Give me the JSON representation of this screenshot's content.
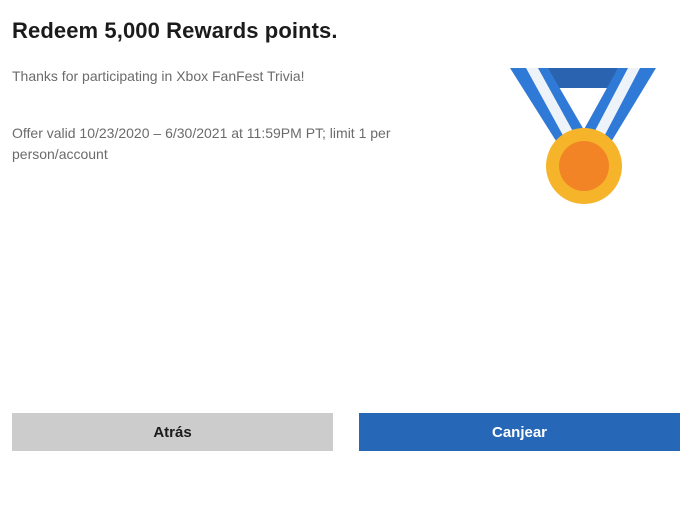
{
  "dialog": {
    "title": "Redeem 5,000 Rewards points.",
    "subtitle": "Thanks for participating in Xbox FanFest Trivia!",
    "offer_text": "Offer valid 10/23/2020 – 6/30/2021 at 11:59PM PT; limit 1 per person/account",
    "image_icon": "medal-icon"
  },
  "buttons": {
    "back_label": "Atrás",
    "redeem_label": "Canjear"
  },
  "colors": {
    "primary": "#2767b8",
    "secondary_button": "#cccccc",
    "medal_gold": "#f6b42a",
    "medal_orange": "#f28426",
    "ribbon_blue": "#2f7ad6",
    "ribbon_dark": "#2a63b0"
  }
}
